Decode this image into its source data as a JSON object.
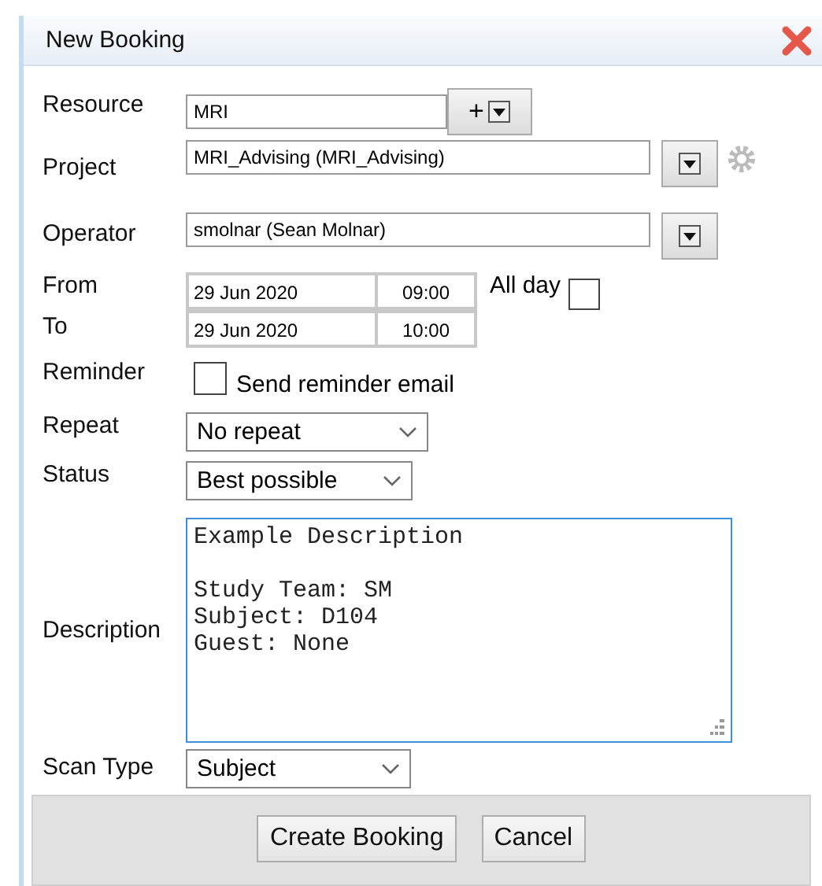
{
  "dialog": {
    "title": "New Booking"
  },
  "resource": {
    "label": "Resource",
    "value": "MRI",
    "add": "+"
  },
  "project": {
    "label": "Project",
    "value": "MRI_Advising (MRI_Advising)"
  },
  "operator": {
    "label": "Operator",
    "value": "smolnar (Sean Molnar)"
  },
  "from": {
    "label": "From",
    "date": "29 Jun 2020",
    "time": "09:00"
  },
  "to": {
    "label": "To",
    "date": "29 Jun 2020",
    "time": "10:00"
  },
  "all_day": {
    "label": "All day",
    "checked": false
  },
  "reminder": {
    "label": "Reminder",
    "option": "Send reminder email",
    "checked": false
  },
  "repeat": {
    "label": "Repeat",
    "value": "No repeat"
  },
  "status": {
    "label": "Status",
    "value": "Best possible"
  },
  "description": {
    "label": "Description",
    "value": "Example Description\n\nStudy Team: SM\nSubject: D104\nGuest: None",
    "focused": true
  },
  "scan_type": {
    "label": "Scan Type",
    "value": "Subject"
  },
  "buttons": [
    {
      "label": "Create Booking"
    },
    {
      "label": "Cancel"
    }
  ]
}
